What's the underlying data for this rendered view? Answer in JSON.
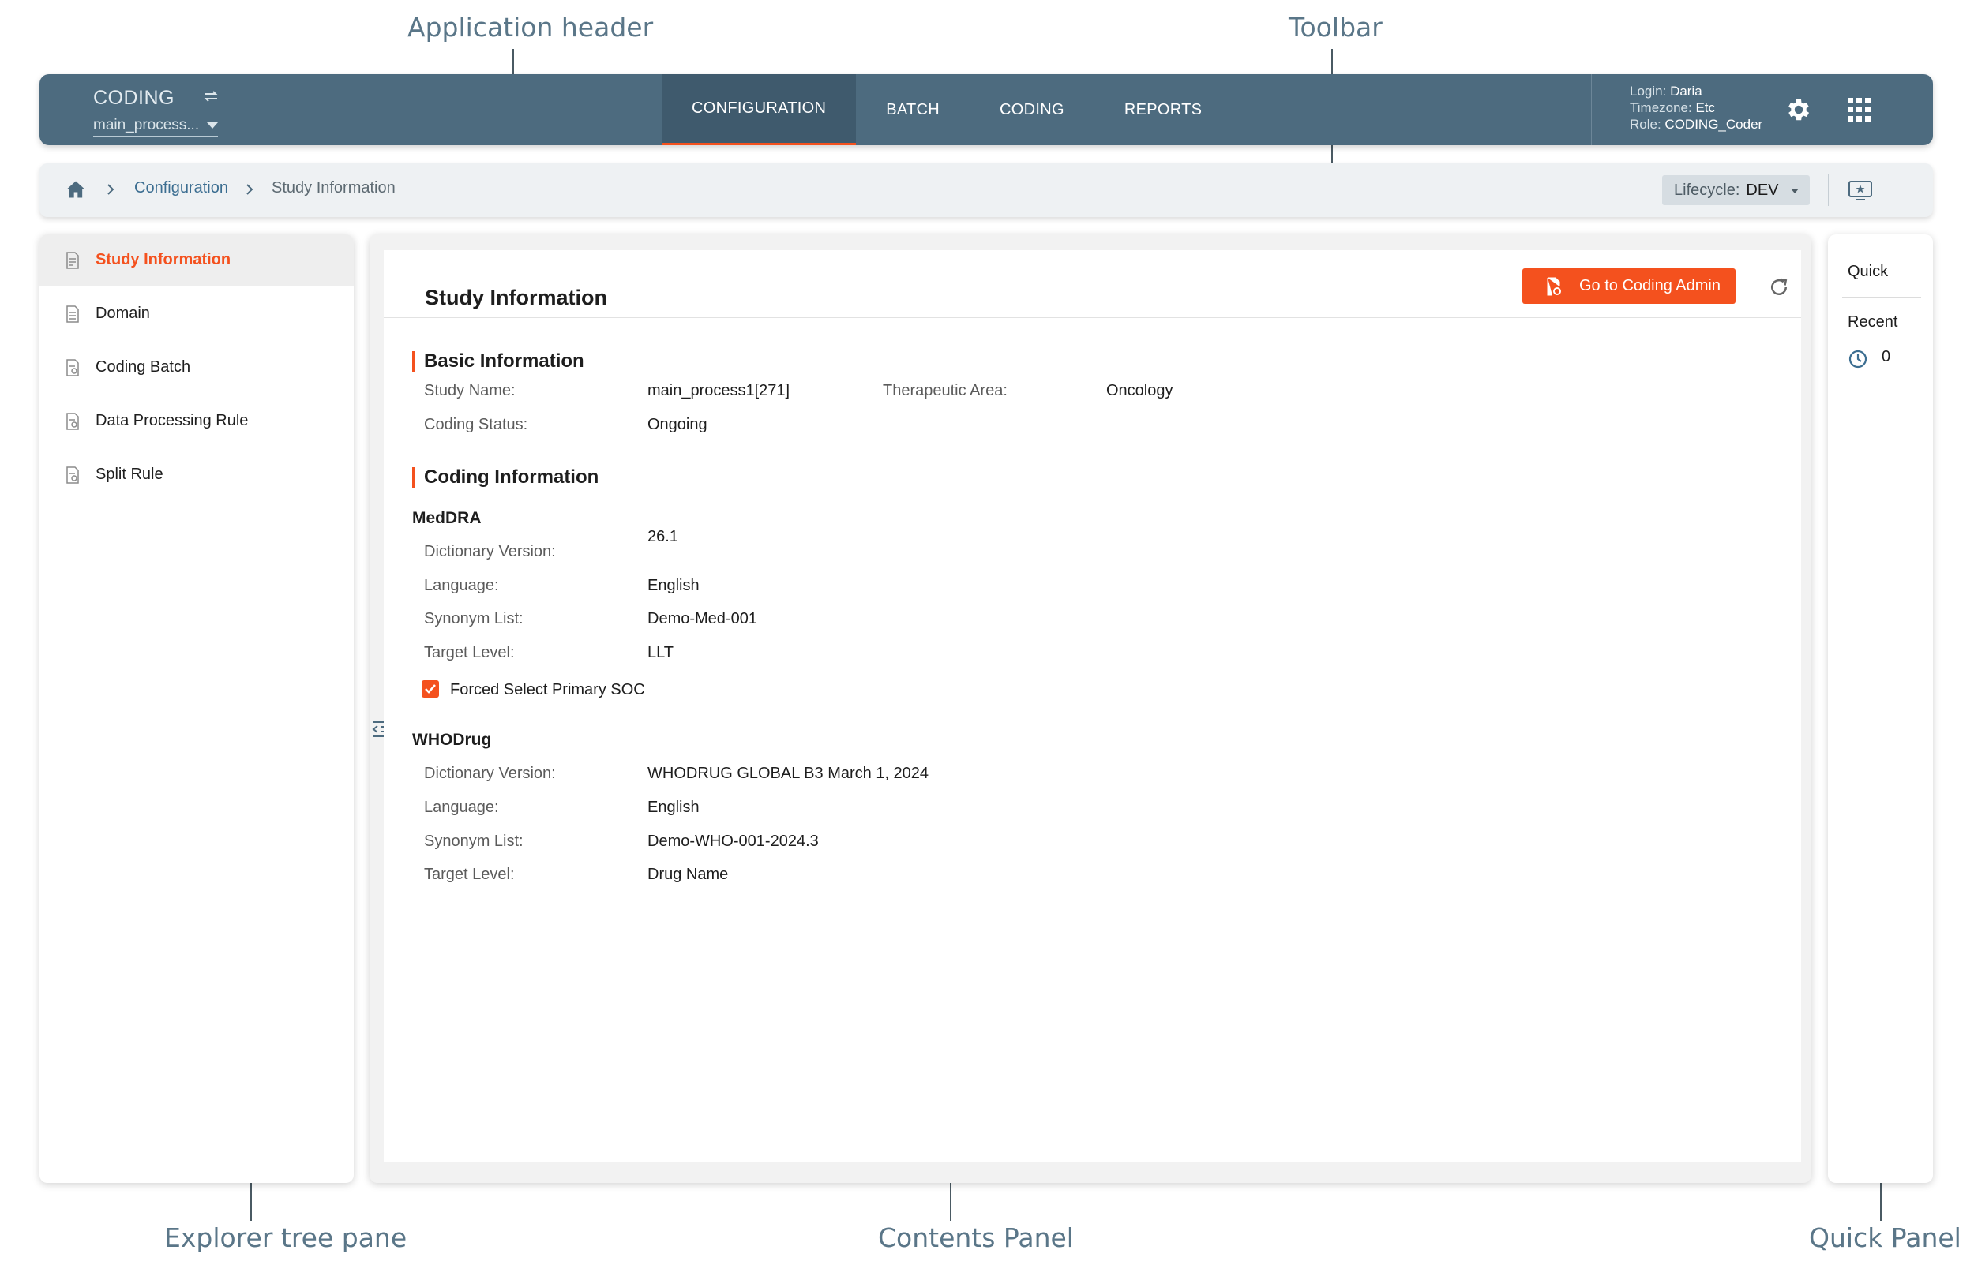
{
  "annotations": {
    "app_header": "Application header",
    "toolbar": "Toolbar",
    "explorer": "Explorer tree pane",
    "contents": "Contents Panel",
    "quick": "Quick Panel"
  },
  "header": {
    "app_name": "CODING",
    "study_selector": "main_process...",
    "tabs": [
      {
        "label": "CONFIGURATION",
        "active": true
      },
      {
        "label": "BATCH",
        "active": false
      },
      {
        "label": "CODING",
        "active": false
      },
      {
        "label": "REPORTS",
        "active": false
      }
    ],
    "user": {
      "login_label": "Login:",
      "login": "Daria",
      "timezone_label": "Timezone:",
      "timezone": "Etc",
      "role_label": "Role:",
      "role": "CODING_Coder"
    },
    "icons": [
      "swap-icon",
      "gear-icon",
      "apps-grid-icon"
    ]
  },
  "toolbar": {
    "breadcrumb": [
      {
        "label": "Configuration",
        "link": true
      },
      {
        "label": "Study Information",
        "link": false
      }
    ],
    "lifecycle_label": "Lifecycle:",
    "lifecycle_value": "DEV",
    "icons": [
      "home-icon",
      "present-icon"
    ]
  },
  "explorer": {
    "items": [
      {
        "label": "Study Information",
        "active": true
      },
      {
        "label": "Domain",
        "active": false
      },
      {
        "label": "Coding Batch",
        "active": false
      },
      {
        "label": "Data Processing Rule",
        "active": false
      },
      {
        "label": "Split Rule",
        "active": false
      }
    ]
  },
  "contents": {
    "title": "Study Information",
    "admin_button": "Go to Coding Admin",
    "basic": {
      "heading": "Basic Information",
      "study_name_label": "Study Name:",
      "study_name": "main_process1[271]",
      "therapeutic_area_label": "Therapeutic Area:",
      "therapeutic_area": "Oncology",
      "coding_status_label": "Coding Status:",
      "coding_status": "Ongoing"
    },
    "coding": {
      "heading": "Coding Information",
      "meddra": {
        "title": "MedDRA",
        "dictionary_version_label": "Dictionary Version:",
        "dictionary_version": "26.1",
        "language_label": "Language:",
        "language": "English",
        "synonym_list_label": "Synonym List:",
        "synonym_list": "Demo-Med-001",
        "target_level_label": "Target Level:",
        "target_level": "LLT",
        "forced_soc_label": "Forced Select Primary SOC",
        "forced_soc_checked": true
      },
      "whodrug": {
        "title": "WHODrug",
        "dictionary_version_label": "Dictionary Version:",
        "dictionary_version": "WHODRUG GLOBAL B3 March 1, 2024",
        "language_label": "Language:",
        "language": "English",
        "synonym_list_label": "Synonym List:",
        "synonym_list": "Demo-WHO-001-2024.3",
        "target_level_label": "Target Level:",
        "target_level": "Drug Name"
      }
    }
  },
  "quick": {
    "quick_label": "Quick",
    "recent_label": "Recent",
    "recent_count": "0"
  },
  "colors": {
    "header_bg": "#4d6b7f",
    "accent": "#f4511e",
    "link": "#3c6e91"
  }
}
